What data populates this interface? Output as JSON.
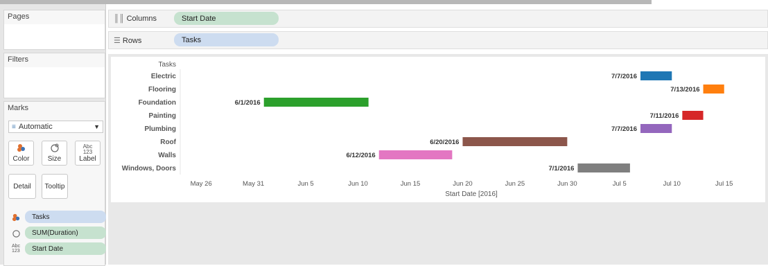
{
  "columns_shelf": {
    "label": "Columns",
    "pill": "Start Date"
  },
  "rows_shelf": {
    "label": "Rows",
    "pill": "Tasks"
  },
  "pages_card": {
    "title": "Pages"
  },
  "filters_card": {
    "title": "Filters"
  },
  "marks_card": {
    "title": "Marks",
    "mark_type": "Automatic",
    "buttons": {
      "color": "Color",
      "size": "Size",
      "label": "Label",
      "detail": "Detail",
      "tooltip": "Tooltip"
    },
    "size_icon_text": "Abc\n123",
    "fields": [
      {
        "icon": "color-icon",
        "label": "Tasks",
        "color": "#cddcf0"
      },
      {
        "icon": "size-icon",
        "label": "SUM(Duration)",
        "color": "#c6e2cf"
      },
      {
        "icon": "label-icon",
        "label": "Start Date",
        "color": "#c6e2cf"
      }
    ]
  },
  "colors": {
    "columns_pill": "#c6e2cf",
    "rows_pill": "#cddcf0"
  },
  "chart_data": {
    "type": "bar",
    "orientation": "horizontal",
    "gantt": true,
    "row_header": "Tasks",
    "xlabel": "Start Date [2016]",
    "x_ticks": [
      "May 26",
      "May 31",
      "Jun 5",
      "Jun 10",
      "Jun 15",
      "Jun 20",
      "Jun 25",
      "Jun 30",
      "Jul 5",
      "Jul 10",
      "Jul 15"
    ],
    "xlim": [
      "2016-05-24",
      "2016-07-18"
    ],
    "grid": false,
    "tasks": [
      {
        "name": "Electric",
        "start": "2016-07-07",
        "duration": 3,
        "label": "7/7/2016",
        "color": "#1f77b4"
      },
      {
        "name": "Flooring",
        "start": "2016-07-13",
        "duration": 2,
        "label": "7/13/2016",
        "color": "#ff7f0e"
      },
      {
        "name": "Foundation",
        "start": "2016-06-01",
        "duration": 10,
        "label": "6/1/2016",
        "color": "#2ca02c"
      },
      {
        "name": "Painting",
        "start": "2016-07-11",
        "duration": 2,
        "label": "7/11/2016",
        "color": "#d62728"
      },
      {
        "name": "Plumbing",
        "start": "2016-07-07",
        "duration": 3,
        "label": "7/7/2016",
        "color": "#9467bd"
      },
      {
        "name": "Roof",
        "start": "2016-06-20",
        "duration": 10,
        "label": "6/20/2016",
        "color": "#8c564b"
      },
      {
        "name": "Walls",
        "start": "2016-06-12",
        "duration": 7,
        "label": "6/12/2016",
        "color": "#e377c2"
      },
      {
        "name": "Windows, Doors",
        "start": "2016-07-01",
        "duration": 5,
        "label": "7/1/2016",
        "color": "#7f7f7f"
      }
    ]
  }
}
